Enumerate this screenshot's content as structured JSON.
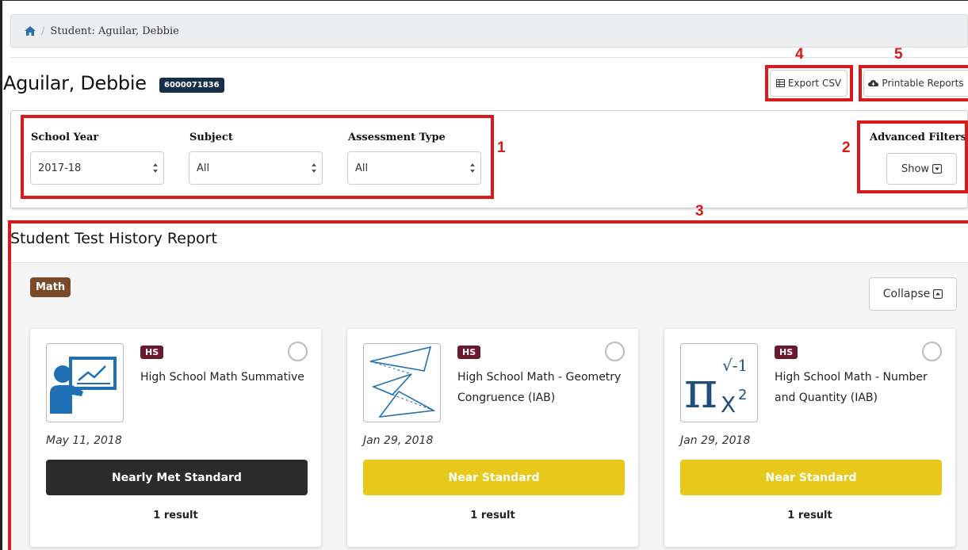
{
  "breadcrumb": {
    "current": "Student: Aguilar, Debbie"
  },
  "student": {
    "name": "Aguilar, Debbie",
    "ssid": "6000071836"
  },
  "actions": {
    "export_csv": "Export CSV",
    "printable_reports": "Printable Reports"
  },
  "filters": {
    "school_year": {
      "label": "School Year",
      "value": "2017-18"
    },
    "subject": {
      "label": "Subject",
      "value": "All"
    },
    "assessment_type": {
      "label": "Assessment Type",
      "value": "All"
    },
    "advanced": {
      "label": "Advanced Filters",
      "button": "Show"
    }
  },
  "callouts": [
    "1",
    "2",
    "3",
    "4",
    "5"
  ],
  "callout_color": "#d9191a",
  "report": {
    "title": "Student Test History Report",
    "subject_badge": "Math",
    "collapse": "Collapse"
  },
  "cards": [
    {
      "grade": "HS",
      "title": "High School Math Summative",
      "date": "May 11, 2018",
      "level": "Nearly Met Standard",
      "level_color": "#2b2b2b",
      "level_text_color": "#ffffff",
      "result": "1 result",
      "icon": "presenter-chart-icon"
    },
    {
      "grade": "HS",
      "title": "High School Math - Geometry Congruence (IAB)",
      "date": "Jan 29, 2018",
      "level": "Near Standard",
      "level_color": "#e9c81c",
      "level_text_color": "#ffffff",
      "result": "1 result",
      "icon": "triangles-icon"
    },
    {
      "grade": "HS",
      "title": "High School Math - Number and Quantity (IAB)",
      "date": "Jan 29, 2018",
      "level": "Near Standard",
      "level_color": "#e9c81c",
      "level_text_color": "#ffffff",
      "result": "1 result",
      "icon": "pi-exponent-icon",
      "icon_text": {
        "pi": "π",
        "root": "√-1",
        "base": "X",
        "exp": "2"
      }
    }
  ]
}
